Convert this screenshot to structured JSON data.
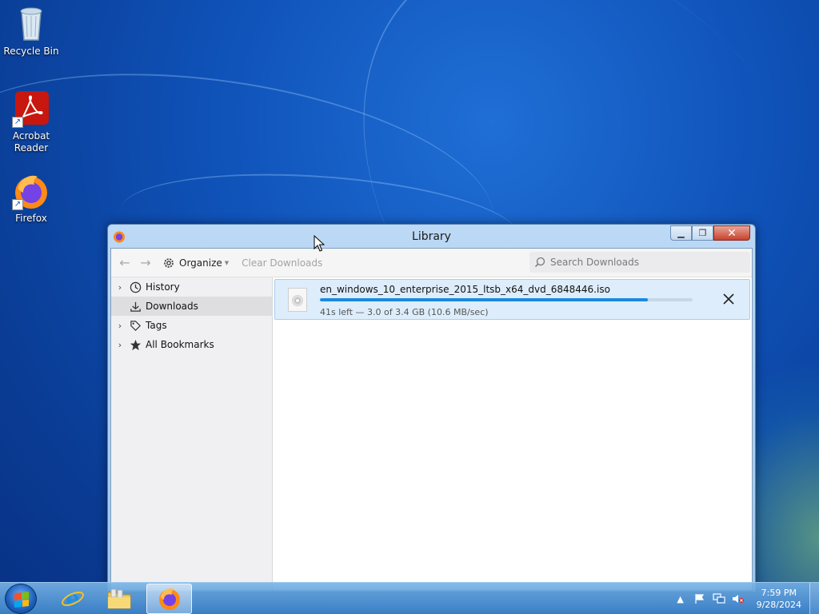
{
  "desktop": {
    "icons": [
      {
        "label": "Recycle Bin",
        "icon": "recycle-bin-icon"
      },
      {
        "label_line1": "Acrobat",
        "label_line2": "Reader",
        "icon": "acrobat-reader-icon"
      },
      {
        "label": "Firefox",
        "icon": "firefox-icon"
      }
    ]
  },
  "window": {
    "title": "Library",
    "icon": "firefox-icon",
    "caption_buttons": [
      "minimize",
      "maximize",
      "close"
    ]
  },
  "toolbar": {
    "back_icon": "back-arrow-icon",
    "forward_icon": "forward-arrow-icon",
    "organize_label": "Organize",
    "clear_label": "Clear Downloads",
    "search_placeholder": "Search Downloads"
  },
  "sidebar": {
    "items": [
      {
        "label": "History",
        "icon": "clock-icon",
        "expandable": true
      },
      {
        "label": "Downloads",
        "icon": "download-icon",
        "expandable": false,
        "selected": true
      },
      {
        "label": "Tags",
        "icon": "tag-icon",
        "expandable": true
      },
      {
        "label": "All Bookmarks",
        "icon": "star-icon",
        "expandable": true
      }
    ]
  },
  "downloads": [
    {
      "filename": "en_windows_10_enterprise_2015_ltsb_x64_dvd_6848446.iso",
      "status": "41s left — 3.0 of 3.4 GB (10.6 MB/sec)",
      "progress_fraction": 0.88,
      "icon": "disc-file-icon"
    }
  ],
  "taskbar": {
    "items": [
      "start-button",
      "internet-explorer",
      "file-explorer",
      "firefox"
    ],
    "active": "firefox"
  },
  "tray": {
    "time": "7:59 PM",
    "date": "9/28/2024"
  },
  "colors": {
    "accent": "#1a8ae0",
    "selection": "#deedfb",
    "close_button": "#c7412e"
  }
}
